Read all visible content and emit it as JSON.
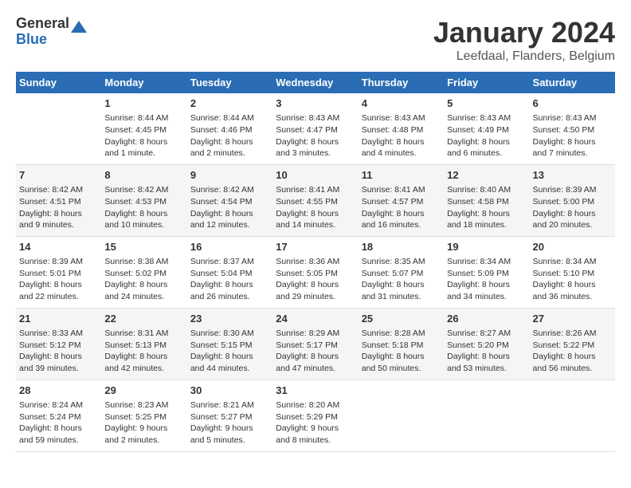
{
  "header": {
    "logo_general": "General",
    "logo_blue": "Blue",
    "month_title": "January 2024",
    "location": "Leefdaal, Flanders, Belgium"
  },
  "weekdays": [
    "Sunday",
    "Monday",
    "Tuesday",
    "Wednesday",
    "Thursday",
    "Friday",
    "Saturday"
  ],
  "weeks": [
    [
      {
        "day": "",
        "info": ""
      },
      {
        "day": "1",
        "info": "Sunrise: 8:44 AM\nSunset: 4:45 PM\nDaylight: 8 hours\nand 1 minute."
      },
      {
        "day": "2",
        "info": "Sunrise: 8:44 AM\nSunset: 4:46 PM\nDaylight: 8 hours\nand 2 minutes."
      },
      {
        "day": "3",
        "info": "Sunrise: 8:43 AM\nSunset: 4:47 PM\nDaylight: 8 hours\nand 3 minutes."
      },
      {
        "day": "4",
        "info": "Sunrise: 8:43 AM\nSunset: 4:48 PM\nDaylight: 8 hours\nand 4 minutes."
      },
      {
        "day": "5",
        "info": "Sunrise: 8:43 AM\nSunset: 4:49 PM\nDaylight: 8 hours\nand 6 minutes."
      },
      {
        "day": "6",
        "info": "Sunrise: 8:43 AM\nSunset: 4:50 PM\nDaylight: 8 hours\nand 7 minutes."
      }
    ],
    [
      {
        "day": "7",
        "info": "Sunrise: 8:42 AM\nSunset: 4:51 PM\nDaylight: 8 hours\nand 9 minutes."
      },
      {
        "day": "8",
        "info": "Sunrise: 8:42 AM\nSunset: 4:53 PM\nDaylight: 8 hours\nand 10 minutes."
      },
      {
        "day": "9",
        "info": "Sunrise: 8:42 AM\nSunset: 4:54 PM\nDaylight: 8 hours\nand 12 minutes."
      },
      {
        "day": "10",
        "info": "Sunrise: 8:41 AM\nSunset: 4:55 PM\nDaylight: 8 hours\nand 14 minutes."
      },
      {
        "day": "11",
        "info": "Sunrise: 8:41 AM\nSunset: 4:57 PM\nDaylight: 8 hours\nand 16 minutes."
      },
      {
        "day": "12",
        "info": "Sunrise: 8:40 AM\nSunset: 4:58 PM\nDaylight: 8 hours\nand 18 minutes."
      },
      {
        "day": "13",
        "info": "Sunrise: 8:39 AM\nSunset: 5:00 PM\nDaylight: 8 hours\nand 20 minutes."
      }
    ],
    [
      {
        "day": "14",
        "info": "Sunrise: 8:39 AM\nSunset: 5:01 PM\nDaylight: 8 hours\nand 22 minutes."
      },
      {
        "day": "15",
        "info": "Sunrise: 8:38 AM\nSunset: 5:02 PM\nDaylight: 8 hours\nand 24 minutes."
      },
      {
        "day": "16",
        "info": "Sunrise: 8:37 AM\nSunset: 5:04 PM\nDaylight: 8 hours\nand 26 minutes."
      },
      {
        "day": "17",
        "info": "Sunrise: 8:36 AM\nSunset: 5:05 PM\nDaylight: 8 hours\nand 29 minutes."
      },
      {
        "day": "18",
        "info": "Sunrise: 8:35 AM\nSunset: 5:07 PM\nDaylight: 8 hours\nand 31 minutes."
      },
      {
        "day": "19",
        "info": "Sunrise: 8:34 AM\nSunset: 5:09 PM\nDaylight: 8 hours\nand 34 minutes."
      },
      {
        "day": "20",
        "info": "Sunrise: 8:34 AM\nSunset: 5:10 PM\nDaylight: 8 hours\nand 36 minutes."
      }
    ],
    [
      {
        "day": "21",
        "info": "Sunrise: 8:33 AM\nSunset: 5:12 PM\nDaylight: 8 hours\nand 39 minutes."
      },
      {
        "day": "22",
        "info": "Sunrise: 8:31 AM\nSunset: 5:13 PM\nDaylight: 8 hours\nand 42 minutes."
      },
      {
        "day": "23",
        "info": "Sunrise: 8:30 AM\nSunset: 5:15 PM\nDaylight: 8 hours\nand 44 minutes."
      },
      {
        "day": "24",
        "info": "Sunrise: 8:29 AM\nSunset: 5:17 PM\nDaylight: 8 hours\nand 47 minutes."
      },
      {
        "day": "25",
        "info": "Sunrise: 8:28 AM\nSunset: 5:18 PM\nDaylight: 8 hours\nand 50 minutes."
      },
      {
        "day": "26",
        "info": "Sunrise: 8:27 AM\nSunset: 5:20 PM\nDaylight: 8 hours\nand 53 minutes."
      },
      {
        "day": "27",
        "info": "Sunrise: 8:26 AM\nSunset: 5:22 PM\nDaylight: 8 hours\nand 56 minutes."
      }
    ],
    [
      {
        "day": "28",
        "info": "Sunrise: 8:24 AM\nSunset: 5:24 PM\nDaylight: 8 hours\nand 59 minutes."
      },
      {
        "day": "29",
        "info": "Sunrise: 8:23 AM\nSunset: 5:25 PM\nDaylight: 9 hours\nand 2 minutes."
      },
      {
        "day": "30",
        "info": "Sunrise: 8:21 AM\nSunset: 5:27 PM\nDaylight: 9 hours\nand 5 minutes."
      },
      {
        "day": "31",
        "info": "Sunrise: 8:20 AM\nSunset: 5:29 PM\nDaylight: 9 hours\nand 8 minutes."
      },
      {
        "day": "",
        "info": ""
      },
      {
        "day": "",
        "info": ""
      },
      {
        "day": "",
        "info": ""
      }
    ]
  ]
}
